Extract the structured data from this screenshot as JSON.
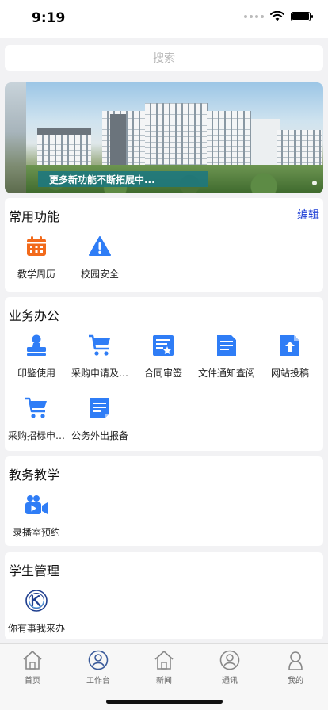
{
  "status": {
    "time": "9:19"
  },
  "search": {
    "placeholder": "搜索"
  },
  "banner": {
    "caption": "更多新功能不断拓展中..."
  },
  "common": {
    "title": "常用功能",
    "edit_label": "编辑",
    "items": [
      {
        "label": "教学周历",
        "icon": "calendar-icon"
      },
      {
        "label": "校园安全",
        "icon": "warning-icon"
      }
    ]
  },
  "office": {
    "title": "业务办公",
    "items": [
      {
        "label": "印鉴使用",
        "icon": "stamp-icon"
      },
      {
        "label": "采购申请及…",
        "icon": "cart-icon"
      },
      {
        "label": "合同审签",
        "icon": "contract-icon"
      },
      {
        "label": "文件通知查阅",
        "icon": "document-icon"
      },
      {
        "label": "网站投稿",
        "icon": "upload-file-icon"
      },
      {
        "label": "采购招标申…",
        "icon": "cart-icon"
      },
      {
        "label": "公务外出报备",
        "icon": "report-icon"
      }
    ]
  },
  "teaching": {
    "title": "教务教学",
    "items": [
      {
        "label": "录播室预约",
        "icon": "video-camera-icon"
      }
    ]
  },
  "students": {
    "title": "学生管理",
    "items": [
      {
        "label": "你有事我来办",
        "icon": "school-logo-icon"
      }
    ]
  },
  "tabbar": {
    "items": [
      {
        "label": "首页",
        "icon": "home-icon",
        "active": false
      },
      {
        "label": "工作台",
        "icon": "workbench-icon",
        "active": true
      },
      {
        "label": "新闻",
        "icon": "news-home-icon",
        "active": false
      },
      {
        "label": "通讯",
        "icon": "contacts-icon",
        "active": false
      },
      {
        "label": "我的",
        "icon": "profile-icon",
        "active": false
      }
    ]
  },
  "colors": {
    "accent_blue": "#2f7df6",
    "calendar_orange": "#f26a1b",
    "edit_link": "#1f3fd6"
  }
}
